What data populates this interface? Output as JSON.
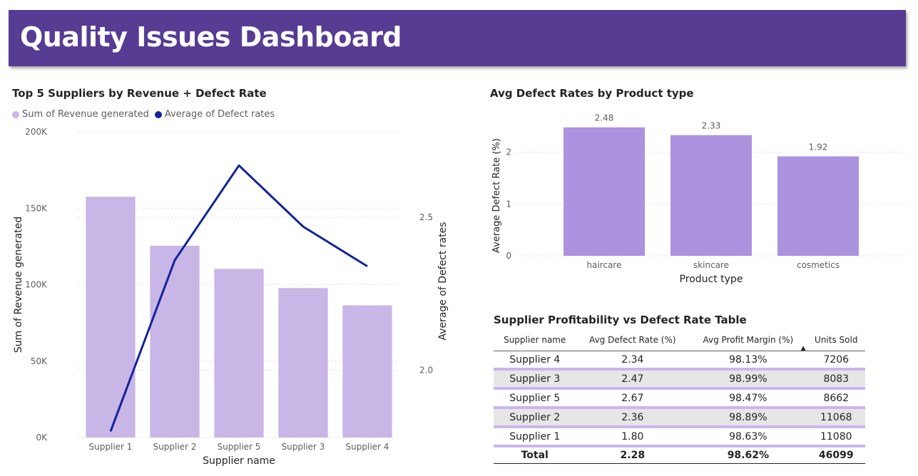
{
  "header": {
    "title": "Quality Issues Dashboard"
  },
  "colors": {
    "banner": "#563C92",
    "bar_left": "#C8B6E6",
    "bar_right": "#AB93DF",
    "line": "#12239E"
  },
  "chart_data": [
    {
      "type": "bar+line",
      "title": "Top 5 Suppliers by Revenue + Defect Rate",
      "categories": [
        "Supplier 1",
        "Supplier 2",
        "Supplier 5",
        "Supplier 3",
        "Supplier 4"
      ],
      "series": [
        {
          "name": "Sum of Revenue generated",
          "type": "bar",
          "axis": "left",
          "values": [
            157529,
            125467,
            110343,
            97795,
            86469
          ]
        },
        {
          "name": "Average of Defect rates",
          "type": "line",
          "axis": "right",
          "values": [
            1.8,
            2.36,
            2.67,
            2.47,
            2.34
          ]
        }
      ],
      "xlabel": "Supplier name",
      "ylabel": "Sum of Revenue generated",
      "y2label": "Average of Defect rates",
      "ylim": [
        0,
        200000
      ],
      "y2lim": [
        1.78,
        2.78
      ],
      "yticks": [
        "0K",
        "50K",
        "100K",
        "150K",
        "200K"
      ],
      "y2ticks": [
        "2.0",
        "2.5"
      ],
      "legend": "top-left",
      "grid": true
    },
    {
      "type": "bar",
      "title": "Avg Defect Rates by Product type",
      "categories": [
        "haircare",
        "skincare",
        "cosmetics"
      ],
      "values": [
        2.48,
        2.33,
        1.92
      ],
      "data_labels": [
        "2.48",
        "2.33",
        "1.92"
      ],
      "xlabel": "Product type",
      "ylabel": "Average Defect Rate (%)",
      "ylim": [
        0,
        2.6
      ],
      "yticks": [
        "0",
        "1",
        "2"
      ],
      "grid": true
    }
  ],
  "table": {
    "title": "Supplier Profitability vs Defect Rate Table",
    "columns": [
      "Supplier name",
      "Avg Defect Rate (%)",
      "Avg Profit Margin (%)",
      "Units Sold"
    ],
    "rows": [
      [
        "Supplier 4",
        "2.34",
        "98.13%",
        "7206"
      ],
      [
        "Supplier 3",
        "2.47",
        "98.99%",
        "8083"
      ],
      [
        "Supplier 5",
        "2.67",
        "98.47%",
        "8662"
      ],
      [
        "Supplier 2",
        "2.36",
        "98.89%",
        "11068"
      ],
      [
        "Supplier 1",
        "1.80",
        "98.63%",
        "11080"
      ]
    ],
    "total": [
      "Total",
      "2.28",
      "98.62%",
      "46099"
    ],
    "sort_indicator": "▲"
  }
}
